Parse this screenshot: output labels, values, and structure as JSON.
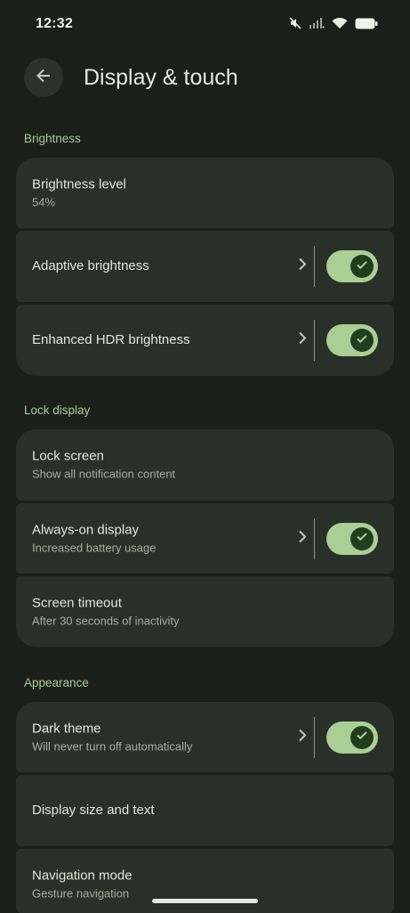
{
  "status": {
    "time": "12:32"
  },
  "header": {
    "title": "Display & touch"
  },
  "sections": {
    "brightness": "Brightness",
    "lock": "Lock display",
    "appearance": "Appearance"
  },
  "brightness": {
    "level": {
      "title": "Brightness level",
      "subtitle": "54%"
    },
    "adaptive": {
      "title": "Adaptive brightness",
      "enabled": true
    },
    "hdr": {
      "title": "Enhanced HDR brightness",
      "enabled": true
    }
  },
  "lock": {
    "screen": {
      "title": "Lock screen",
      "subtitle": "Show all notification content"
    },
    "aod": {
      "title": "Always-on display",
      "subtitle": "Increased battery usage",
      "enabled": true
    },
    "timeout": {
      "title": "Screen timeout",
      "subtitle": "After 30 seconds of inactivity"
    }
  },
  "appearance": {
    "dark": {
      "title": "Dark theme",
      "subtitle": "Will never turn off automatically",
      "enabled": true
    },
    "size": {
      "title": "Display size and text"
    },
    "nav": {
      "title": "Navigation mode",
      "subtitle": "Gesture navigation"
    }
  },
  "colors": {
    "background": "#1b1e19",
    "card": "#2b2f29",
    "accent": "#a8cf96",
    "toggle_on": "#a9cf94",
    "toggle_knob": "#223d1d"
  }
}
